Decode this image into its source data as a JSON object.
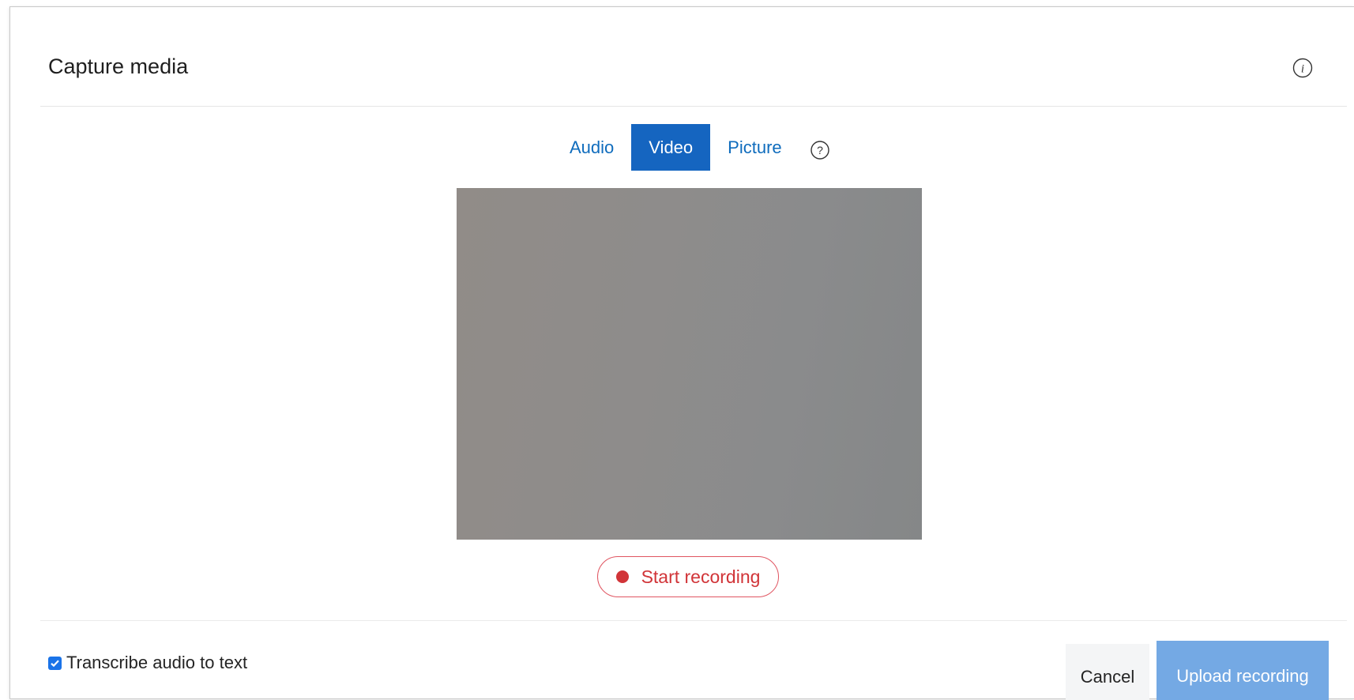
{
  "dialog": {
    "title": "Capture media",
    "info_icon": "info-icon"
  },
  "tabs": [
    {
      "label": "Audio",
      "active": false
    },
    {
      "label": "Video",
      "active": true
    },
    {
      "label": "Picture",
      "active": false
    }
  ],
  "help_icon": "help-icon",
  "record": {
    "label": "Start recording",
    "icon": "record-dot-icon"
  },
  "footer": {
    "transcribe_label": "Transcribe audio to text",
    "transcribe_checked": true,
    "cancel_label": "Cancel",
    "upload_label": "Upload recording"
  },
  "colors": {
    "accent": "#1565c0",
    "link": "#0f6cbd",
    "record": "#d13438",
    "upload_disabled": "#74a9e4"
  }
}
